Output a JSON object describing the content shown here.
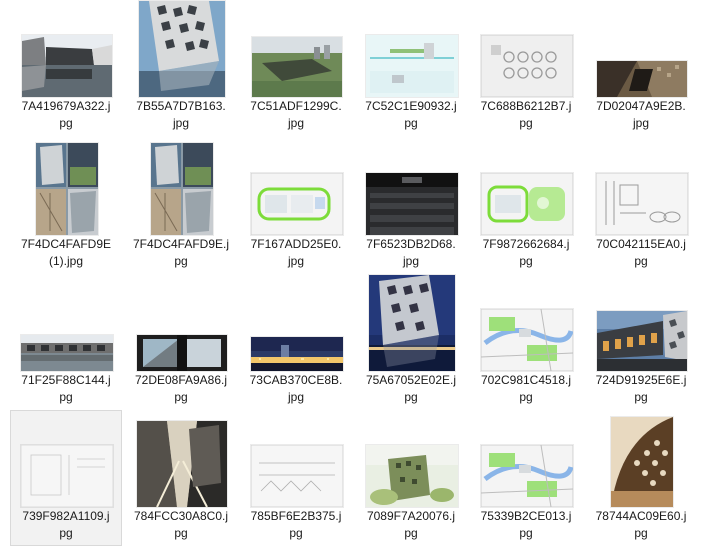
{
  "files": [
    {
      "name": "7A419679A322.jpg",
      "line1": "7A419679A322.j",
      "line2": "pg",
      "thumb": "bldg-reflect",
      "selected": false
    },
    {
      "name": "7B55A7D7B163.jpg",
      "line1": "7B55A7D7B163.",
      "line2": "jpg",
      "thumb": "facade-sky",
      "selected": false
    },
    {
      "name": "7C51ADF1299C.jpg",
      "line1": "7C51ADF1299C.",
      "line2": "jpg",
      "thumb": "aerial",
      "selected": false
    },
    {
      "name": "7C52C1E90932.jpg",
      "line1": "7C52C1E90932.j",
      "line2": "pg",
      "thumb": "section-pale",
      "selected": false
    },
    {
      "name": "7C688B6212B7.jpg",
      "line1": "7C688B6212B7.j",
      "line2": "pg",
      "thumb": "sheet-circles",
      "selected": false
    },
    {
      "name": "7D02047A9E2B.jpg",
      "line1": "7D02047A9E2B.",
      "line2": "jpg",
      "thumb": "interior-dark",
      "selected": false
    },
    {
      "name": "7F4DC4FAFD9E(1).jpg",
      "line1": "7F4DC4FAFD9E",
      "line2": "(1).jpg",
      "thumb": "collage",
      "selected": false
    },
    {
      "name": "7F4DC4FAFD9E.jpg",
      "line1": "7F4DC4FAFD9E.j",
      "line2": "pg",
      "thumb": "collage",
      "selected": false
    },
    {
      "name": "7F167ADD25E0.jpg",
      "line1": "7F167ADD25E0.",
      "line2": "jpg",
      "thumb": "plan-green",
      "selected": false
    },
    {
      "name": "7F6523DB2D68.jpg",
      "line1": "7F6523DB2D68.",
      "line2": "jpg",
      "thumb": "auditorium",
      "selected": false
    },
    {
      "name": "7F9872662684.jpg",
      "line1": "7F9872662684.j",
      "line2": "pg",
      "thumb": "plan-green2",
      "selected": false
    },
    {
      "name": "70C042115EA0.jpg",
      "line1": "70C042115EA0.j",
      "line2": "pg",
      "thumb": "detail-sheet",
      "selected": false
    },
    {
      "name": "71F25F88C144.jpg",
      "line1": "71F25F88C144.j",
      "line2": "pg",
      "thumb": "bldg-reflect2",
      "selected": false
    },
    {
      "name": "72DE08FA9A86.jpg",
      "line1": "72DE08FA9A86.j",
      "line2": "pg",
      "thumb": "window-frame",
      "selected": false
    },
    {
      "name": "73CAB370CE8B.jpg",
      "line1": "73CAB370CE8B.",
      "line2": "jpg",
      "thumb": "night-skyline",
      "selected": false
    },
    {
      "name": "75A67052E02E.jpg",
      "line1": "75A67052E02E.j",
      "line2": "pg",
      "thumb": "night-tower",
      "selected": false
    },
    {
      "name": "702C981C4518.jpg",
      "line1": "702C981C4518.j",
      "line2": "pg",
      "thumb": "site-plan",
      "selected": false
    },
    {
      "name": "724D91925E6E.jpg",
      "line1": "724D91925E6E.j",
      "line2": "pg",
      "thumb": "long-bldg",
      "selected": false
    },
    {
      "name": "739F982A1109.jpg",
      "line1": "739F982A1109.j",
      "line2": "pg",
      "thumb": "blank-sheet",
      "selected": true
    },
    {
      "name": "784FCC30A8C0.jpg",
      "line1": "784FCC30A8C0.j",
      "line2": "pg",
      "thumb": "corridor",
      "selected": false
    },
    {
      "name": "785BF6E2B375.jpg",
      "line1": "785BF6E2B375.j",
      "line2": "pg",
      "thumb": "elevation-sheet",
      "selected": false
    },
    {
      "name": "7089F7A20076.jpg",
      "line1": "7089F7A20076.j",
      "line2": "pg",
      "thumb": "render-green",
      "selected": false
    },
    {
      "name": "75339B2CE013.jpg",
      "line1": "75339B2CE013.j",
      "line2": "pg",
      "thumb": "site-plan",
      "selected": false
    },
    {
      "name": "78744AC09E60.jpg",
      "line1": "78744AC09E60.j",
      "line2": "pg",
      "thumb": "lattice-tall",
      "selected": false
    }
  ]
}
